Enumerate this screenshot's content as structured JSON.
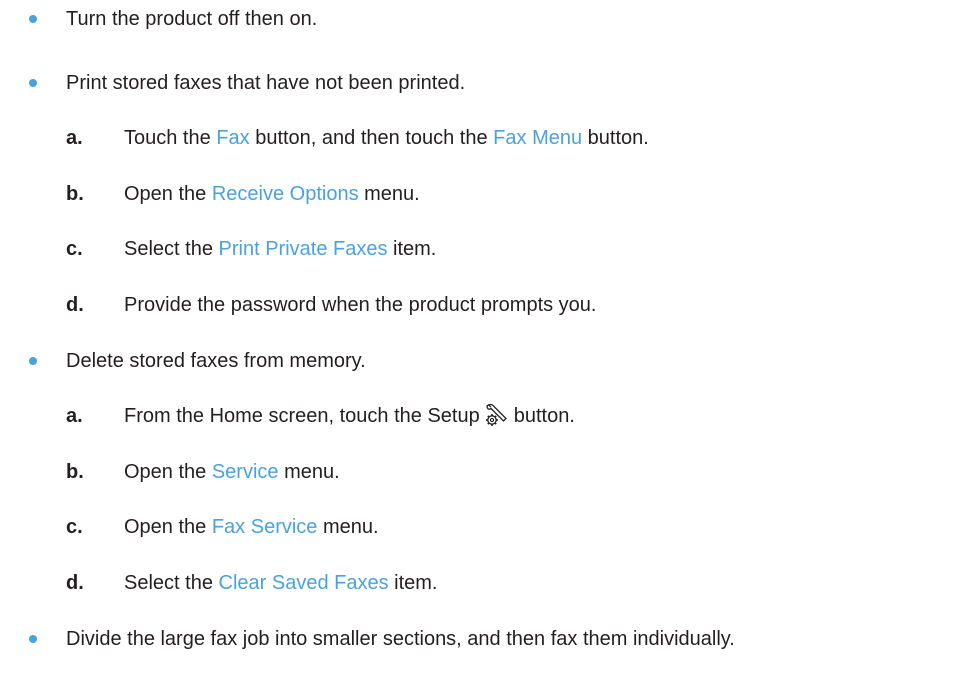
{
  "accent_color": "#4aa2dd",
  "text_color": "#231f20",
  "items": [
    {
      "type": "bullet",
      "text": "Turn the product off then on."
    },
    {
      "type": "bullet",
      "text": "Print stored faxes that have not been printed."
    },
    {
      "type": "step",
      "letter": "a.",
      "parts": [
        "Touch the ",
        "Fax",
        " button, and then touch the ",
        "Fax Menu",
        " button."
      ]
    },
    {
      "type": "step",
      "letter": "b.",
      "parts": [
        "Open the ",
        "Receive Options",
        " menu."
      ]
    },
    {
      "type": "step",
      "letter": "c.",
      "parts": [
        "Select the ",
        "Print Private Faxes",
        " item."
      ]
    },
    {
      "type": "step",
      "letter": "d.",
      "text": "Provide the password when the product prompts you."
    },
    {
      "type": "bullet",
      "text": "Delete stored faxes from memory."
    },
    {
      "type": "step",
      "letter": "a.",
      "before": "From the Home screen, touch the Setup",
      "icon": "setup-wrench-gear-icon",
      "after": "button."
    },
    {
      "type": "step",
      "letter": "b.",
      "parts": [
        "Open the ",
        "Service",
        " menu."
      ]
    },
    {
      "type": "step",
      "letter": "c.",
      "parts": [
        "Open the ",
        "Fax Service",
        " menu."
      ]
    },
    {
      "type": "step",
      "letter": "d.",
      "parts": [
        "Select the ",
        "Clear Saved Faxes",
        " item."
      ]
    },
    {
      "type": "bullet",
      "text": "Divide the large fax job into smaller sections, and then fax them individually."
    }
  ]
}
